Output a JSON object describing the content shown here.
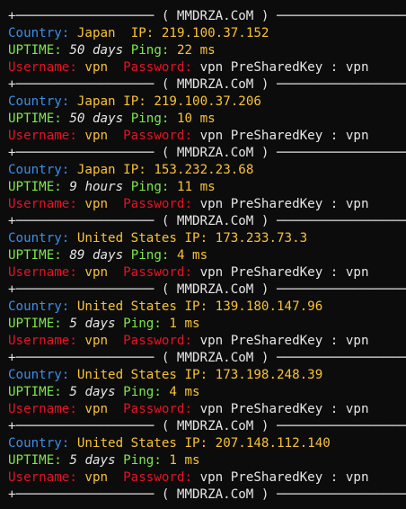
{
  "separator": {
    "left": "+──────────────────",
    "label": "( MMDRZA.CoM )",
    "right": "──────────────────+"
  },
  "labels": {
    "country": "Country:",
    "ip": "IP:",
    "uptime": "UPTIME:",
    "ping": "Ping:",
    "username": "Username:",
    "password": "Password:",
    "psk": "PreSharedKey :"
  },
  "entries": [
    {
      "country": "Japan ",
      "ip": "219.100.37.152",
      "uptime_num": "50",
      "uptime_unit": "days",
      "ping": "22 ms",
      "username": "vpn",
      "password": "vpn",
      "psk": "vpn"
    },
    {
      "country": "Japan",
      "ip": "219.100.37.206",
      "uptime_num": "50",
      "uptime_unit": "days",
      "ping": "10 ms",
      "username": "vpn",
      "password": "vpn",
      "psk": "vpn"
    },
    {
      "country": "Japan",
      "ip": "153.232.23.68",
      "uptime_num": "9",
      "uptime_unit": "hours",
      "ping": "11 ms",
      "username": "vpn",
      "password": "vpn",
      "psk": "vpn"
    },
    {
      "country": "United States",
      "ip": "173.233.73.3",
      "uptime_num": "89",
      "uptime_unit": "days",
      "ping": "4 ms",
      "username": "vpn",
      "password": "vpn",
      "psk": "vpn"
    },
    {
      "country": "United States",
      "ip": "139.180.147.96",
      "uptime_num": "5",
      "uptime_unit": "days",
      "ping": "1 ms",
      "username": "vpn",
      "password": "vpn",
      "psk": "vpn"
    },
    {
      "country": "United States",
      "ip": "173.198.248.39",
      "uptime_num": "5",
      "uptime_unit": "days",
      "ping": "4 ms",
      "username": "vpn",
      "password": "vpn",
      "psk": "vpn"
    },
    {
      "country": "United States",
      "ip": "207.148.112.140",
      "uptime_num": "5",
      "uptime_unit": "days",
      "ping": "1 ms",
      "username": "vpn",
      "password": "vpn",
      "psk": "vpn"
    }
  ],
  "colors": {
    "background": "#0c0c0c",
    "country_label": "#3b8eea",
    "value": "#f9c235",
    "uptime_label": "#7ee84a",
    "credential_label": "#e81123"
  }
}
